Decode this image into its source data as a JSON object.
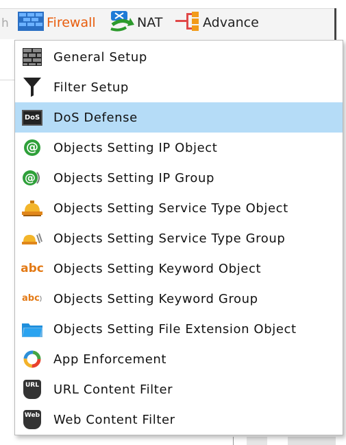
{
  "toolbar": {
    "cut_text": "h",
    "items": [
      {
        "label": "Firewall",
        "icon": "firewall-icon"
      },
      {
        "label": "NAT",
        "icon": "nat-icon"
      },
      {
        "label": "Advance",
        "icon": "advance-icon"
      }
    ]
  },
  "menu": {
    "items": [
      {
        "label": "General Setup",
        "icon": "brick-wall-icon"
      },
      {
        "label": "Filter Setup",
        "icon": "funnel-icon"
      },
      {
        "label": "DoS Defense",
        "icon": "dos-icon",
        "icon_text": "DoS",
        "selected": true
      },
      {
        "label": "Objects Setting IP Object",
        "icon": "at-sign-icon",
        "icon_text": "@"
      },
      {
        "label": "Objects Setting IP Group",
        "icon": "at-sign-group-icon",
        "icon_text": "@"
      },
      {
        "label": "Objects Setting Service Type Object",
        "icon": "service-bell-icon"
      },
      {
        "label": "Objects Setting Service Type Group",
        "icon": "service-bell-group-icon"
      },
      {
        "label": "Objects Setting Keyword Object",
        "icon": "abc-icon",
        "icon_text": "abc"
      },
      {
        "label": "Objects Setting Keyword Group",
        "icon": "abc-group-icon",
        "icon_text": "abc"
      },
      {
        "label": "Objects Setting File Extension Object",
        "icon": "folder-icon"
      },
      {
        "label": "App Enforcement",
        "icon": "app-ring-icon"
      },
      {
        "label": "URL Content Filter",
        "icon": "url-filter-icon",
        "icon_text": "URL"
      },
      {
        "label": "Web Content Filter",
        "icon": "web-filter-icon",
        "icon_text": "Web"
      }
    ]
  },
  "colors": {
    "selected_bg": "#b5dcf7",
    "firewall_label": "#e85c0c"
  }
}
